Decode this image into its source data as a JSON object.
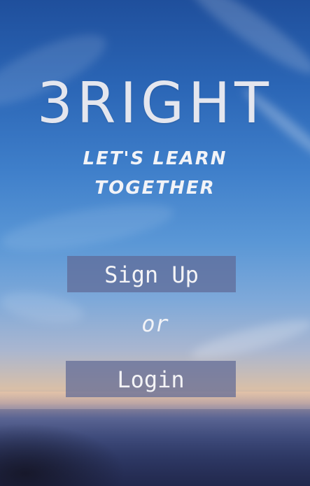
{
  "app": {
    "title": "3RIGHT",
    "tagline_line1": "LET'S LEARN",
    "tagline_line2": "TOGETHER"
  },
  "actions": {
    "signup_label": "Sign Up",
    "separator": "or",
    "login_label": "Login"
  }
}
